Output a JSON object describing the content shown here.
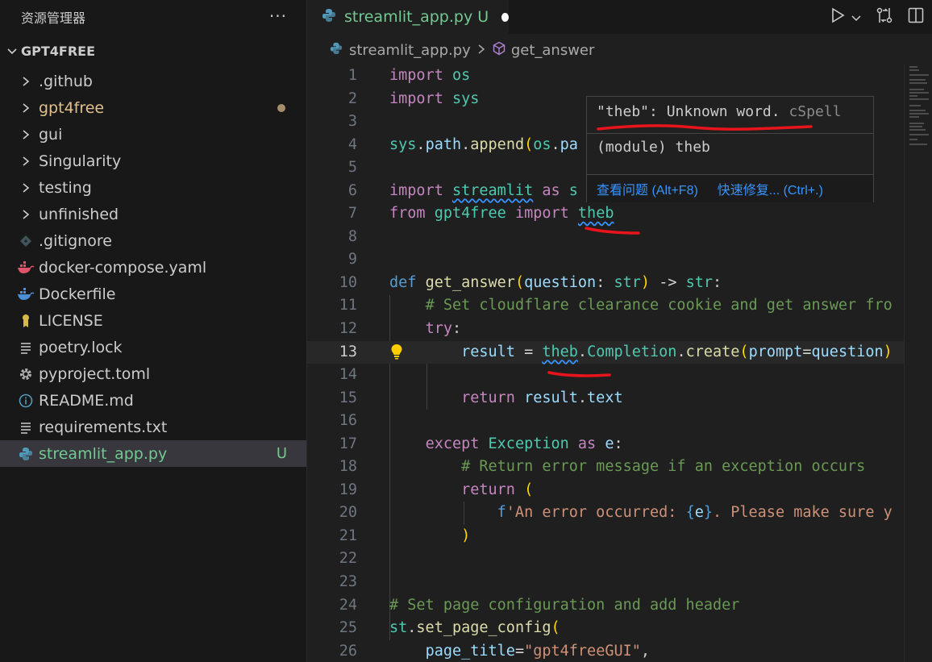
{
  "sidebar": {
    "title": "资源管理器",
    "more": "···",
    "root": "GPT4FREE",
    "items": [
      {
        "label": ".github",
        "type": "folder"
      },
      {
        "label": "gpt4free",
        "type": "folder",
        "modified": true
      },
      {
        "label": "gui",
        "type": "folder"
      },
      {
        "label": "Singularity",
        "type": "folder"
      },
      {
        "label": "testing",
        "type": "folder"
      },
      {
        "label": "unfinished",
        "type": "folder"
      },
      {
        "label": ".gitignore",
        "type": "file",
        "icon": "git-icon"
      },
      {
        "label": "docker-compose.yaml",
        "type": "file",
        "icon": "docker-icon"
      },
      {
        "label": "Dockerfile",
        "type": "file",
        "icon": "docker-icon"
      },
      {
        "label": "LICENSE",
        "type": "file",
        "icon": "license-icon"
      },
      {
        "label": "poetry.lock",
        "type": "file",
        "icon": "lines-icon"
      },
      {
        "label": "pyproject.toml",
        "type": "file",
        "icon": "gear-icon"
      },
      {
        "label": "README.md",
        "type": "file",
        "icon": "info-icon"
      },
      {
        "label": "requirements.txt",
        "type": "file",
        "icon": "lines-icon"
      },
      {
        "label": "streamlit_app.py",
        "type": "file",
        "icon": "python-icon",
        "badge": "U",
        "selected": true
      }
    ]
  },
  "tab": {
    "label": "streamlit_app.py",
    "badge": "U"
  },
  "breadcrumb": {
    "file": "streamlit_app.py",
    "symbol": "get_answer"
  },
  "hover": {
    "word": "\"theb\"",
    "message": ": Unknown word.",
    "source": "cSpell",
    "signature": "(module) theb",
    "view_problem": "查看问题 (Alt+F8)",
    "quick_fix": "快速修复... (Ctrl+.)"
  },
  "colors": {
    "untracked": "#73c991",
    "modified": "#e2c08d",
    "accent": "#3794ff",
    "annotation": "#e8141b"
  },
  "current_line": "13",
  "code_lines": [
    {
      "n": "1",
      "t": "import os"
    },
    {
      "n": "2",
      "t": "import sys"
    },
    {
      "n": "3",
      "t": ""
    },
    {
      "n": "4",
      "t": "sys.path.append(os.pa                        _),"
    },
    {
      "n": "5",
      "t": ""
    },
    {
      "n": "6",
      "t": "import streamlit as s"
    },
    {
      "n": "7",
      "t": "from gpt4free import theb"
    },
    {
      "n": "8",
      "t": ""
    },
    {
      "n": "9",
      "t": ""
    },
    {
      "n": "10",
      "t": "def get_answer(question: str) -> str:"
    },
    {
      "n": "11",
      "t": "    # Set cloudflare clearance cookie and get answer fro"
    },
    {
      "n": "12",
      "t": "    try:"
    },
    {
      "n": "13",
      "t": "        result = theb.Completion.create(prompt=question)"
    },
    {
      "n": "14",
      "t": ""
    },
    {
      "n": "15",
      "t": "        return result.text"
    },
    {
      "n": "16",
      "t": ""
    },
    {
      "n": "17",
      "t": "    except Exception as e:"
    },
    {
      "n": "18",
      "t": "        # Return error message if an exception occurs"
    },
    {
      "n": "19",
      "t": "        return ("
    },
    {
      "n": "20",
      "t": "            f'An error occurred: {e}. Please make sure y"
    },
    {
      "n": "21",
      "t": "        )"
    },
    {
      "n": "22",
      "t": ""
    },
    {
      "n": "23",
      "t": ""
    },
    {
      "n": "24",
      "t": "# Set page configuration and add header"
    },
    {
      "n": "25",
      "t": "st.set_page_config("
    },
    {
      "n": "26",
      "t": "    page_title=\"gpt4freeGUI\","
    }
  ]
}
